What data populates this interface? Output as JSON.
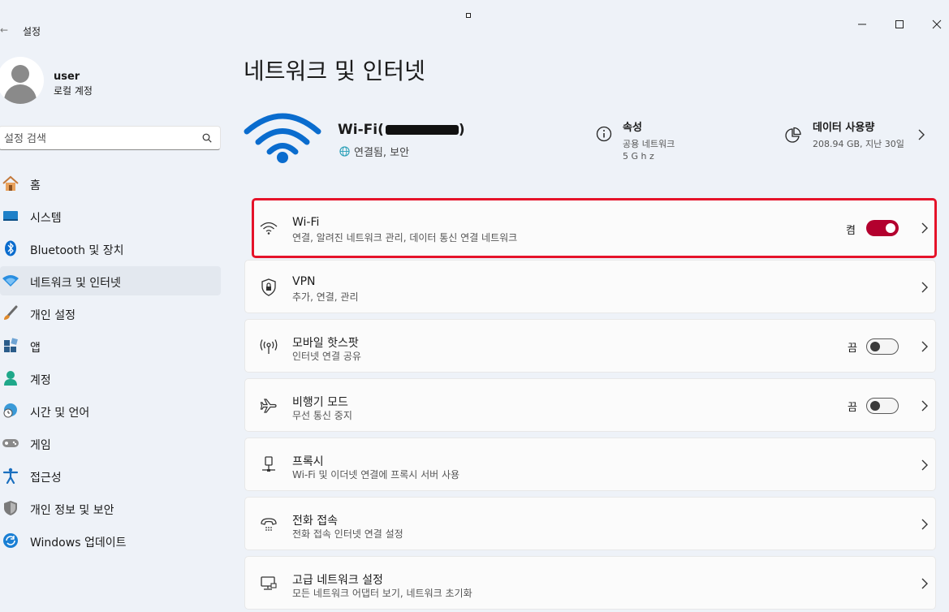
{
  "window": {
    "title": "설정",
    "back_glyph": "←",
    "min_glyph": "—",
    "max_glyph": "☐",
    "close_glyph": "✕"
  },
  "profile": {
    "name": "user",
    "account_type": "로컬 계정"
  },
  "search": {
    "placeholder": "설정 검색"
  },
  "sidebar": {
    "items": [
      {
        "label": "홈",
        "icon": "home-icon"
      },
      {
        "label": "시스템",
        "icon": "system-icon"
      },
      {
        "label": "Bluetooth 및 장치",
        "icon": "bluetooth-icon"
      },
      {
        "label": "네트워크 및 인터넷",
        "icon": "network-icon",
        "active": true
      },
      {
        "label": "개인 설정",
        "icon": "brush-icon"
      },
      {
        "label": "앱",
        "icon": "apps-icon"
      },
      {
        "label": "계정",
        "icon": "account-icon"
      },
      {
        "label": "시간 및 언어",
        "icon": "time-language-icon"
      },
      {
        "label": "게임",
        "icon": "gamepad-icon"
      },
      {
        "label": "접근성",
        "icon": "accessibility-icon"
      },
      {
        "label": "개인 정보 및 보안",
        "icon": "shield-icon"
      },
      {
        "label": "Windows 업데이트",
        "icon": "update-icon"
      }
    ]
  },
  "page": {
    "title": "네트워크 및 인터넷"
  },
  "hero": {
    "network_name": "Wi-Fi(",
    "network_name_end": ")",
    "status": "연결됨, 보안",
    "properties_title": "속성",
    "properties_line1": "공용 네트워크",
    "properties_line2": "5 G h z",
    "usage_title": "데이터 사용량",
    "usage_detail": "208.94 GB, 지난 30일"
  },
  "rows": [
    {
      "title": "Wi-Fi",
      "subtitle": "연결, 알려진 네트워크 관리, 데이터 통신 연결 네트워크",
      "state": "켬",
      "toggle": "on",
      "icon": "wifi-icon"
    },
    {
      "title": "VPN",
      "subtitle": "추가, 연결, 관리",
      "icon": "vpn-shield-icon"
    },
    {
      "title": "모바일 핫스팟",
      "subtitle": "인터넷 연결 공유",
      "state": "끔",
      "toggle": "off",
      "icon": "hotspot-icon"
    },
    {
      "title": "비행기 모드",
      "subtitle": "무선 통신 중지",
      "state": "끔",
      "toggle": "off",
      "icon": "airplane-icon"
    },
    {
      "title": "프록시",
      "subtitle": "Wi-Fi 및 이더넷 연결에 프록시 서버 사용",
      "icon": "proxy-icon"
    },
    {
      "title": "전화 접속",
      "subtitle": "전화 접속 인터넷 연결 설정",
      "icon": "dialup-icon"
    },
    {
      "title": "고급 네트워크 설정",
      "subtitle": "모든 네트워크 어댑터 보기, 네트워크 초기화",
      "icon": "advanced-network-icon"
    }
  ],
  "colors": {
    "accent": "#b3002e",
    "highlight_border": "#e5132a",
    "wifi_blue": "#0a6cce"
  }
}
